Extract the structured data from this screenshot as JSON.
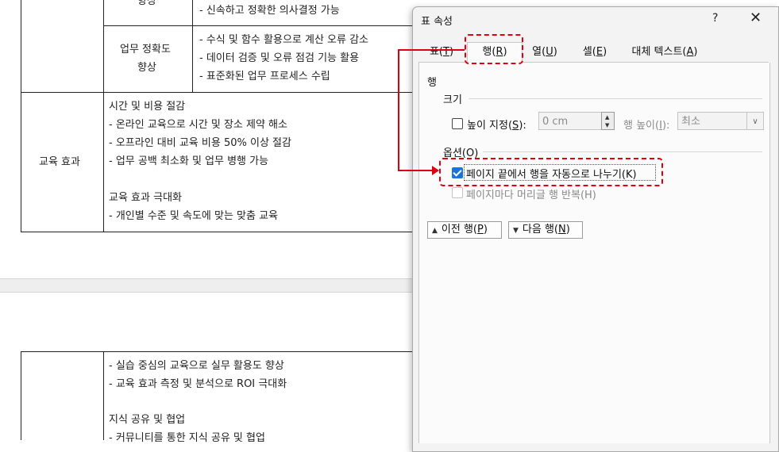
{
  "document": {
    "table1": {
      "row0": {
        "left": "향상",
        "lines": [
          "- 신속하고 정확한 의사결정 가능"
        ]
      },
      "row1": {
        "left_line1": "업무 정확도",
        "left_line2": "향상",
        "lines": [
          "- 수식 및 함수 활용으로 계산 오류 감소",
          "- 데이터 검증 및 오류 점검 기능 활용",
          "- 표준화된 업무 프로세스 수립"
        ]
      },
      "row2": {
        "left": "교육 효과",
        "lines": [
          "시간 및 비용 절감",
          "- 온라인 교육으로 시간 및 장소 제약 해소",
          "- 오프라인 대비 교육 비용 50% 이상 절감",
          "- 업무 공백 최소화 및 업무 병행 가능",
          "교육 효과 극대화",
          "- 개인별 수준 및 속도에 맞는 맞춤 교육"
        ]
      }
    },
    "table2": {
      "lines": [
        "- 실습 중심의 교육으로 실무 활용도 향상",
        "- 교육 효과 측정 및 분석으로 ROI 극대화",
        "지식 공유 및 협업",
        "- 커뮤니티를 통한 지식 공유 및 협업"
      ]
    }
  },
  "dialog": {
    "title": "표 속성",
    "help": "?",
    "close": "✕",
    "tabs": [
      {
        "pre": "표(",
        "key": "T",
        "post": ")"
      },
      {
        "pre": "행(",
        "key": "R",
        "post": ")"
      },
      {
        "pre": "열(",
        "key": "U",
        "post": ")"
      },
      {
        "pre": "셀(",
        "key": "E",
        "post": ")"
      },
      {
        "pre": "대체 텍스트(",
        "key": "A",
        "post": ")"
      }
    ],
    "row_section": "행",
    "size_group": "크기",
    "height_check": {
      "pre": "높이 지정(",
      "key": "S",
      "post": "):",
      "checked": false
    },
    "height_value": "0 cm",
    "row_height_label": {
      "pre": "행 높이(",
      "key": "I",
      "post": "):"
    },
    "row_height_value": "최소",
    "options_group": "옵션(O)",
    "allow_break": {
      "label": "페이지 끝에서 행을 자동으로 나누기(K)",
      "checked": true
    },
    "repeat_header": {
      "label": "페이지마다 머리글 행 반복(H)",
      "checked": false,
      "disabled": true
    },
    "prev_row": {
      "pre": "이전 행(",
      "key": "P",
      "post": ")"
    },
    "next_row": {
      "pre": "다음 행(",
      "key": "N",
      "post": ")"
    }
  },
  "colors": {
    "highlight": "#e0000d",
    "check_blue": "#1a73d9",
    "dialog_bg": "#f3f3f3"
  },
  "icons": [
    "question-icon",
    "close-icon",
    "spin-up-icon",
    "spin-down-icon",
    "chevron-down-icon",
    "triangle-up-icon",
    "triangle-down-icon"
  ]
}
